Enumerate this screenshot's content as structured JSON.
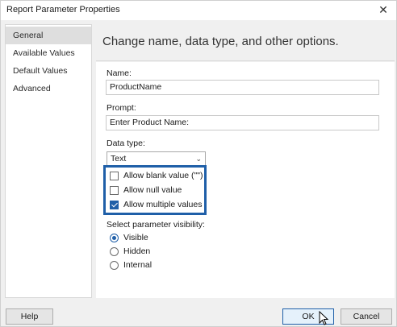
{
  "window": {
    "title": "Report Parameter Properties"
  },
  "nav": {
    "items": [
      {
        "label": "General",
        "selected": true
      },
      {
        "label": "Available Values",
        "selected": false
      },
      {
        "label": "Default Values",
        "selected": false
      },
      {
        "label": "Advanced",
        "selected": false
      }
    ]
  },
  "header": {
    "text": "Change name, data type, and other options."
  },
  "form": {
    "name_label": "Name:",
    "name_value": "ProductName",
    "prompt_label": "Prompt:",
    "prompt_value": "Enter Product Name:",
    "datatype_label": "Data type:",
    "datatype_value": "Text",
    "checkboxes": [
      {
        "label": "Allow blank value (\"\")",
        "checked": false
      },
      {
        "label": "Allow null value",
        "checked": false
      },
      {
        "label": "Allow multiple values",
        "checked": true
      }
    ],
    "visibility_label": "Select parameter visibility:",
    "visibility_options": [
      {
        "label": "Visible",
        "checked": true
      },
      {
        "label": "Hidden",
        "checked": false
      },
      {
        "label": "Internal",
        "checked": false
      }
    ]
  },
  "buttons": {
    "help": "Help",
    "ok": "OK",
    "cancel": "Cancel"
  },
  "colors": {
    "accent": "#1f5fa8",
    "window_bg": "#f0f0f0",
    "panel_bg": "#ffffff"
  },
  "icons": {
    "close": "close-icon",
    "dropdown": "chevron-down-icon",
    "cursor": "mouse-pointer-icon"
  }
}
